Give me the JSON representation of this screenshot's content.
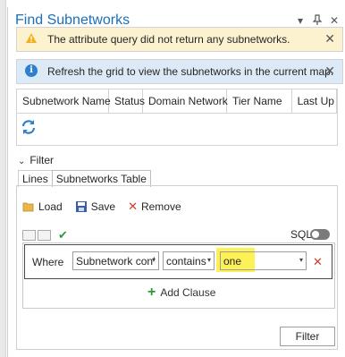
{
  "window": {
    "title": "Find Subnetworks",
    "menu_icon": "chevron-down-icon",
    "pin_icon": "pin-icon",
    "close_icon": "close-icon"
  },
  "messages": {
    "warning": {
      "text": "The attribute query did not  return any subnetworks.",
      "icon": "warning-icon",
      "color": "#f2b01e"
    },
    "info": {
      "text": "Refresh the grid to view the subnetworks in the current map.",
      "icon": "info-icon",
      "color": "#2f7fcf"
    }
  },
  "grid": {
    "columns": [
      "Subnetwork Name",
      "Status",
      "Domain Network",
      "Tier Name",
      "Last Up"
    ],
    "refresh_icon": "refresh-icon"
  },
  "filter": {
    "section_label": "Filter",
    "tabs": [
      "Lines",
      "Subnetworks Table"
    ],
    "active_tab": 1,
    "toolbar": {
      "load": "Load",
      "save": "Save",
      "remove": "Remove"
    },
    "sql_label": "SQL",
    "clause": {
      "where": "Where",
      "field": "Subnetwork con’",
      "operator": "contains",
      "value": "one"
    },
    "add_clause": "Add Clause",
    "filter_button": "Filter"
  },
  "colors": {
    "accent": "#1a70b8",
    "warning_bg": "#fcf2cf",
    "info_bg": "#dceaf8",
    "highlight": "#fbf03a",
    "remove": "#d23a2a",
    "add": "#2f9a3a"
  }
}
